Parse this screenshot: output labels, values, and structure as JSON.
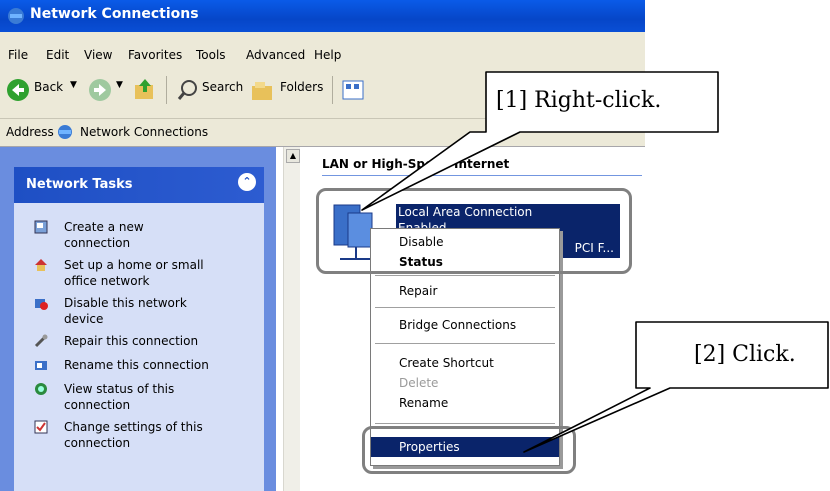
{
  "window": {
    "title": "Network Connections"
  },
  "menu": [
    "File",
    "Edit",
    "View",
    "Favorites",
    "Tools",
    "Advanced",
    "Help"
  ],
  "toolbar": {
    "back_label": "Back",
    "search_label": "Search",
    "folders_label": "Folders"
  },
  "address": {
    "label": "Address",
    "value": "Network Connections"
  },
  "task_pane": {
    "title": "Network Tasks",
    "items": [
      {
        "label1": "Create a new",
        "label2": "connection",
        "icon": "new-connection-icon"
      },
      {
        "label1": "Set up a home or small",
        "label2": "office network",
        "icon": "home-network-icon"
      },
      {
        "label1": "Disable this network",
        "label2": "device",
        "icon": "disable-device-icon"
      },
      {
        "label1": "Repair this connection",
        "label2": "",
        "icon": "repair-icon"
      },
      {
        "label1": "Rename this connection",
        "label2": "",
        "icon": "rename-icon"
      },
      {
        "label1": "View status of this",
        "label2": "connection",
        "icon": "status-icon"
      },
      {
        "label1": "Change settings of this",
        "label2": "connection",
        "icon": "settings-icon"
      }
    ]
  },
  "main": {
    "group_header": "LAN or High-Speed Internet",
    "connection": {
      "name": "Local Area Connection",
      "status": "Enabled",
      "device_suffix": "PCI F..."
    }
  },
  "context_menu": [
    "Disable",
    "Status",
    "Repair",
    "Bridge Connections",
    "Create Shortcut",
    "Delete",
    "Rename",
    "Properties"
  ],
  "callouts": {
    "step1": "[1] Right-click.",
    "step2": "[2] Click."
  },
  "colors": {
    "title_bar": "#0a5be8",
    "selection": "#0a246a",
    "task_panel": "#6a8ddf"
  }
}
